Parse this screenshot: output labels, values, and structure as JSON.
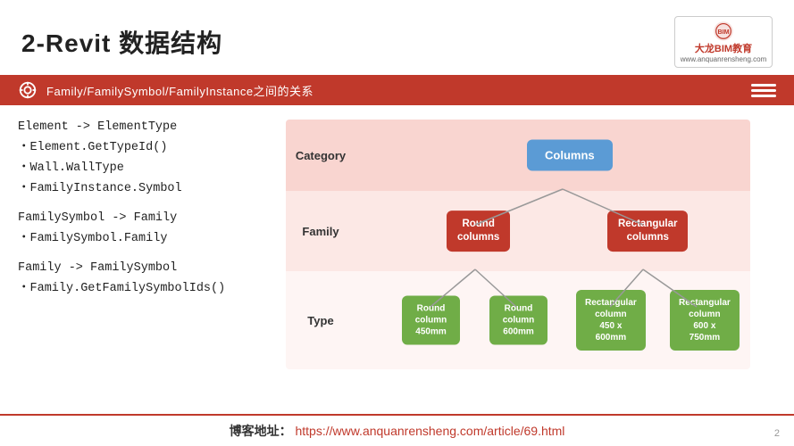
{
  "header": {
    "title": "2-Revit 数据结构",
    "logo_name": "大龙BIM教育",
    "logo_website": "www.anquanrensheng.com"
  },
  "banner": {
    "text": "Family/FamilySymbol/FamilyInstance之间的关系"
  },
  "left": {
    "block1_title": "Element -> ElementType",
    "block1_items": [
      "Element.GetTypeId()",
      "Wall.WallType",
      "FamilyInstance.Symbol"
    ],
    "block2_title": "FamilySymbol -> Family",
    "block2_items": [
      "FamilySymbol.Family"
    ],
    "block3_title": "Family -> FamilySymbol",
    "block3_items": [
      "Family.GetFamilySymbolIds()"
    ]
  },
  "diagram": {
    "rows": [
      {
        "label": "Category"
      },
      {
        "label": "Family"
      },
      {
        "label": "Type"
      }
    ],
    "nodes": {
      "columns": "Columns",
      "round_columns": "Round\ncolumns",
      "rectangular_columns": "Rectangular\ncolumns",
      "round_col_450": "Round\ncolumn\n450mm",
      "round_col_600": "Round\ncolumn\n600mm",
      "rect_col_450": "Rectangular\ncolumn\n450 x\n600mm",
      "rect_col_600": "Rectangular\ncolumn\n600 x\n750mm"
    }
  },
  "footer": {
    "label": "博客地址：",
    "url": "https://www.anquanrensheng.com/article/69.html"
  },
  "page_number": "2"
}
